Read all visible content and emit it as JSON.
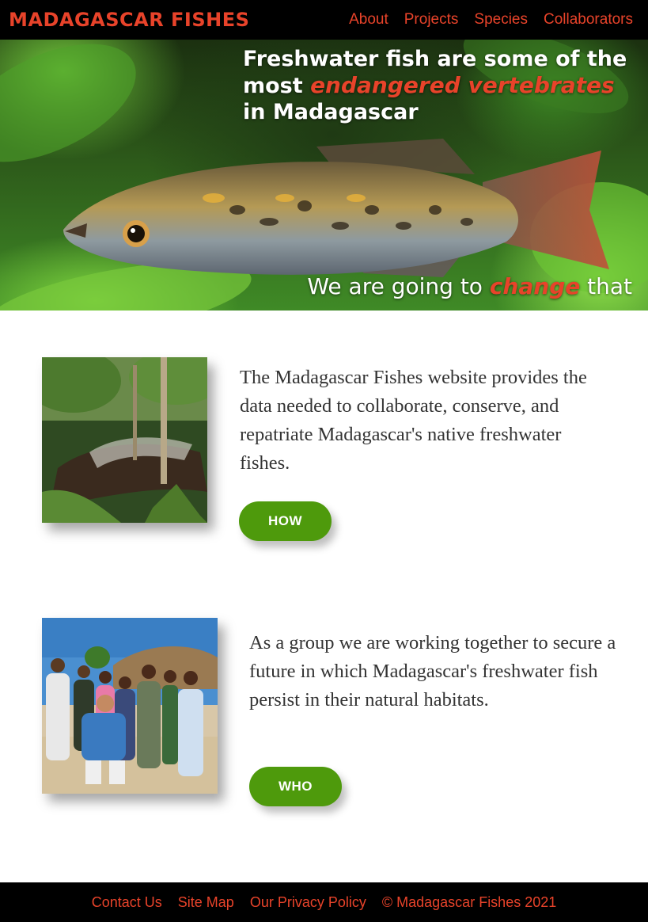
{
  "header": {
    "brand": "MADAGASCAR FISHES",
    "nav": [
      "About",
      "Projects",
      "Species",
      "Collaborators"
    ]
  },
  "hero": {
    "headline_part1": "Freshwater fish are some of the most ",
    "headline_accent": "endangered vertebrates",
    "headline_part2": " in Madagascar",
    "tagline_part1": "We are going to ",
    "tagline_accent": "change",
    "tagline_part2": " that"
  },
  "features": [
    {
      "text": "The Madagascar Fishes website provides the data needed to collaborate, conserve, and repatriate Madagascar's native freshwater fishes.",
      "button": "HOW"
    },
    {
      "text": "As a group we are working together to secure a future in which Madagascar's freshwater fish persist in their natural habitats.",
      "button": "WHO"
    }
  ],
  "footer": {
    "links": [
      "Contact Us",
      "Site Map",
      "Our Privacy Policy"
    ],
    "copyright": "© Madagascar Fishes 2021"
  },
  "colors": {
    "accent": "#e8432a",
    "button": "#4e9a0c",
    "header_bg": "#000000"
  }
}
